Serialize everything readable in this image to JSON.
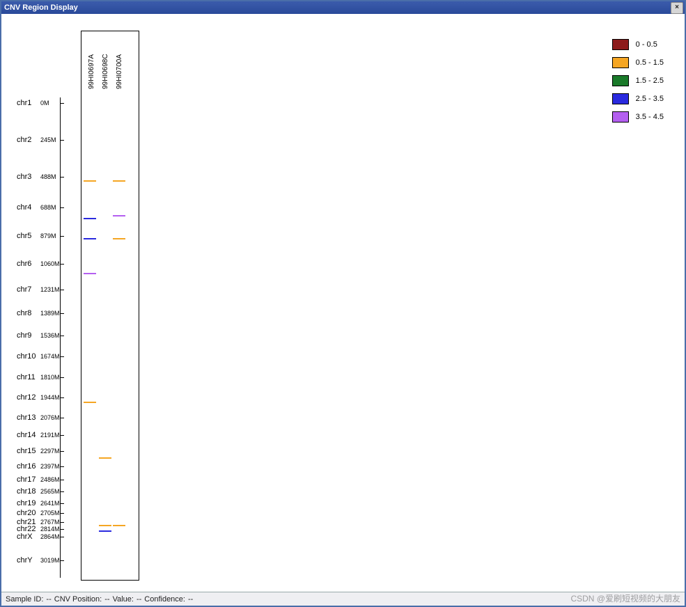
{
  "title": "CNV Region Display",
  "status": {
    "sample_id_label": "Sample ID:",
    "sample_id_value": "--",
    "pos_label": "CNV Position:",
    "pos_value": "--",
    "value_label": "Value:",
    "value_value": "--",
    "conf_label": "Confidence:",
    "conf_value": "--"
  },
  "watermark": "CSDN @爱刷短视频的大朋友",
  "legend": [
    {
      "label": "0 - 0.5",
      "color": "#8d1a1a"
    },
    {
      "label": "0.5 - 1.5",
      "color": "#f5a623"
    },
    {
      "label": "1.5 - 2.5",
      "color": "#1a7a2a"
    },
    {
      "label": "2.5 - 3.5",
      "color": "#2a2adf"
    },
    {
      "label": "3.5 - 4.5",
      "color": "#b45ff0"
    }
  ],
  "chart_data": {
    "type": "heatmap",
    "title": "CNV Region Display",
    "samples": [
      "99HI0697A",
      "99HI0698C",
      "99HI0700A"
    ],
    "y_axis": {
      "chromosomes": [
        "chr1",
        "chr2",
        "chr3",
        "chr4",
        "chr5",
        "chr6",
        "chr7",
        "chr8",
        "chr9",
        "chr10",
        "chr11",
        "chr12",
        "chr13",
        "chr14",
        "chr15",
        "chr16",
        "chr17",
        "chr18",
        "chr19",
        "chr20",
        "chr21",
        "chr22",
        "chrX",
        "chrY"
      ],
      "start_positions": [
        "0M",
        "245M",
        "488M",
        "688M",
        "879M",
        "1060M",
        "1231M",
        "1389M",
        "1536M",
        "1674M",
        "1810M",
        "1944M",
        "2076M",
        "2191M",
        "2297M",
        "2397M",
        "2486M",
        "2565M",
        "2641M",
        "2705M",
        "2767M",
        "2814M",
        "2864M",
        "3019M"
      ],
      "range_Mb": [
        0,
        3019
      ]
    },
    "color_scale_bins": [
      "0 - 0.5",
      "0.5 - 1.5",
      "1.5 - 2.5",
      "2.5 - 3.5",
      "3.5 - 4.5"
    ],
    "cnv_segments": [
      {
        "sample": "99HI0697A",
        "position_Mb": 510,
        "value_bin": "0.5 - 1.5"
      },
      {
        "sample": "99HI0700A",
        "position_Mb": 510,
        "value_bin": "0.5 - 1.5"
      },
      {
        "sample": "99HI0697A",
        "position_Mb": 760,
        "value_bin": "2.5 - 3.5"
      },
      {
        "sample": "99HI0700A",
        "position_Mb": 740,
        "value_bin": "3.5 - 4.5"
      },
      {
        "sample": "99HI0697A",
        "position_Mb": 890,
        "value_bin": "2.5 - 3.5"
      },
      {
        "sample": "99HI0700A",
        "position_Mb": 890,
        "value_bin": "0.5 - 1.5"
      },
      {
        "sample": "99HI0697A",
        "position_Mb": 1120,
        "value_bin": "3.5 - 4.5"
      },
      {
        "sample": "99HI0697A",
        "position_Mb": 1970,
        "value_bin": "0.5 - 1.5"
      },
      {
        "sample": "99HI0698C",
        "position_Mb": 2340,
        "value_bin": "0.5 - 1.5"
      },
      {
        "sample": "99HI0698C",
        "position_Mb": 2785,
        "value_bin": "0.5 - 1.5"
      },
      {
        "sample": "99HI0700A",
        "position_Mb": 2785,
        "value_bin": "0.5 - 1.5"
      },
      {
        "sample": "99HI0698C",
        "position_Mb": 2820,
        "value_bin": "2.5 - 3.5"
      }
    ]
  }
}
